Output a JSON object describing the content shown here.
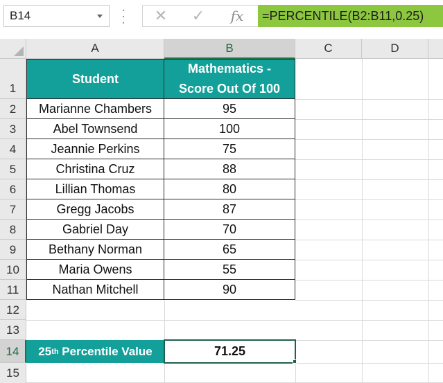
{
  "formula_bar": {
    "name_box": "B14",
    "cancel_glyph": "✕",
    "enter_glyph": "✓",
    "fx_label": "fx",
    "formula": "=PERCENTILE(B2:B11,0.25)"
  },
  "columns": [
    "A",
    "B",
    "C",
    "D"
  ],
  "rows": [
    "1",
    "2",
    "3",
    "4",
    "5",
    "6",
    "7",
    "8",
    "9",
    "10",
    "11",
    "12",
    "13",
    "14",
    "15"
  ],
  "header": {
    "student": "Student",
    "score_line1": "Mathematics -",
    "score_line2": "Score Out Of 100"
  },
  "students": [
    {
      "name": "Marianne Chambers",
      "score": "95"
    },
    {
      "name": "Abel Townsend",
      "score": "100"
    },
    {
      "name": "Jeannie Perkins",
      "score": "75"
    },
    {
      "name": "Christina Cruz",
      "score": "88"
    },
    {
      "name": "Lillian Thomas",
      "score": "80"
    },
    {
      "name": "Gregg Jacobs",
      "score": "87"
    },
    {
      "name": "Gabriel Day",
      "score": "70"
    },
    {
      "name": "Bethany Norman",
      "score": "65"
    },
    {
      "name": "Maria Owens",
      "score": "55"
    },
    {
      "name": "Nathan Mitchell",
      "score": "90"
    }
  ],
  "result": {
    "label_prefix": "25",
    "label_sup": "th",
    "label_suffix": " Percentile Value",
    "value": "71.25"
  },
  "colors": {
    "header_fill": "#13a09a",
    "formula_highlight": "#8dc63f",
    "selection_border": "#1f5f4f"
  }
}
